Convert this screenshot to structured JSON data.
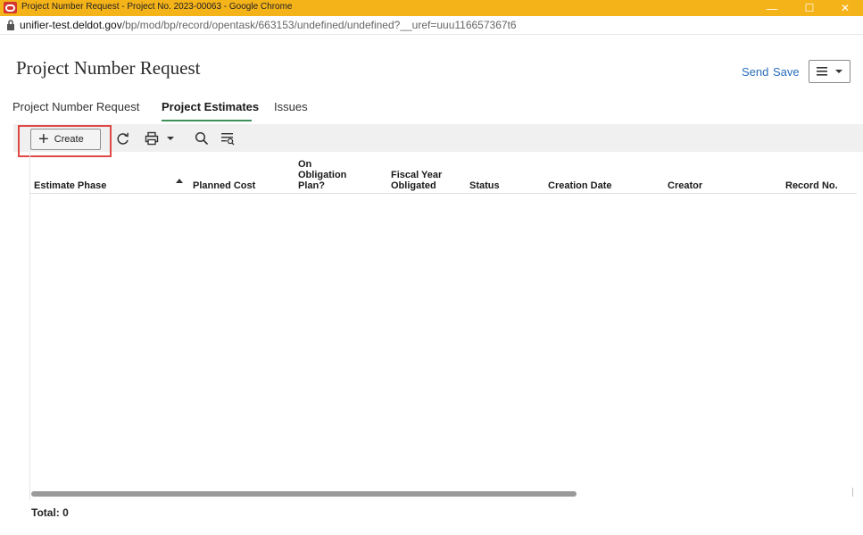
{
  "window": {
    "title": "Project Number Request - Project No. 2023-00063 - Google Chrome",
    "controls": {
      "minimize": "—",
      "maximize": "☐",
      "close": "✕"
    }
  },
  "address": {
    "domain": "unifier-test.deldot.gov",
    "path": "/bp/mod/bp/record/opentask/663153/undefined/undefined?__uref=uuu116657367t6"
  },
  "header": {
    "title": "Project Number Request",
    "send_label": "Send",
    "save_label": "Save",
    "menu_icon": "hamburger-menu-icon"
  },
  "tabs": [
    {
      "label": "Project Number Request",
      "active": false
    },
    {
      "label": "Project Estimates",
      "active": true
    },
    {
      "label": "Issues",
      "active": false
    }
  ],
  "toolbar": {
    "create_label": "Create",
    "icons": [
      "plus-icon",
      "refresh-icon",
      "print-icon",
      "chevron-down-icon",
      "search-icon",
      "filter-list-icon"
    ]
  },
  "grid": {
    "columns": [
      {
        "label": "Estimate Phase"
      },
      {
        "label": "Planned Cost",
        "sorted": "asc"
      },
      {
        "label": "On Obligation Plan?"
      },
      {
        "label": "Fiscal Year Obligated"
      },
      {
        "label": "Status"
      },
      {
        "label": "Creation Date"
      },
      {
        "label": "Creator"
      },
      {
        "label": "Record No."
      }
    ],
    "rows": [],
    "total_label": "Total: 0"
  },
  "colors": {
    "titlebar": "#f5b31a",
    "link": "#2a6ebb",
    "active_tab_underline": "#3f8f5a",
    "highlight": "#e04848"
  }
}
